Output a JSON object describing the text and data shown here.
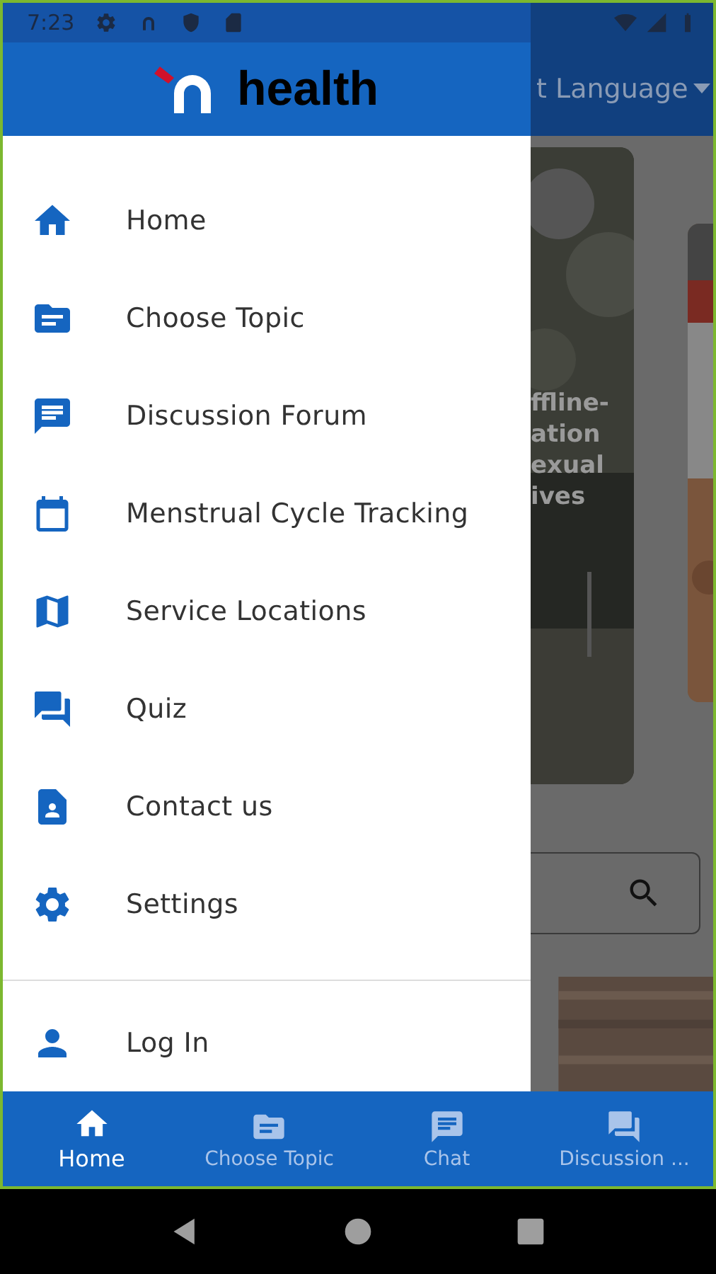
{
  "status_bar": {
    "time": "7:23"
  },
  "drawer": {
    "logo_text": "health",
    "items": [
      {
        "label": "Home"
      },
      {
        "label": "Choose Topic"
      },
      {
        "label": "Discussion Forum"
      },
      {
        "label": "Menstrual Cycle Tracking"
      },
      {
        "label": "Service Locations"
      },
      {
        "label": "Quiz"
      },
      {
        "label": "Contact us"
      },
      {
        "label": "Settings"
      }
    ],
    "footer_items": [
      {
        "label": "Log In"
      }
    ]
  },
  "background": {
    "language_label": "t Language",
    "card_text_lines": [
      "ffline-",
      "ation",
      "exual",
      "ives"
    ]
  },
  "bottom_nav": {
    "items": [
      {
        "label": "Home",
        "selected": true
      },
      {
        "label": "Choose Topic",
        "selected": false
      },
      {
        "label": "Chat",
        "selected": false
      },
      {
        "label": "Discussion ...",
        "selected": false
      }
    ]
  }
}
